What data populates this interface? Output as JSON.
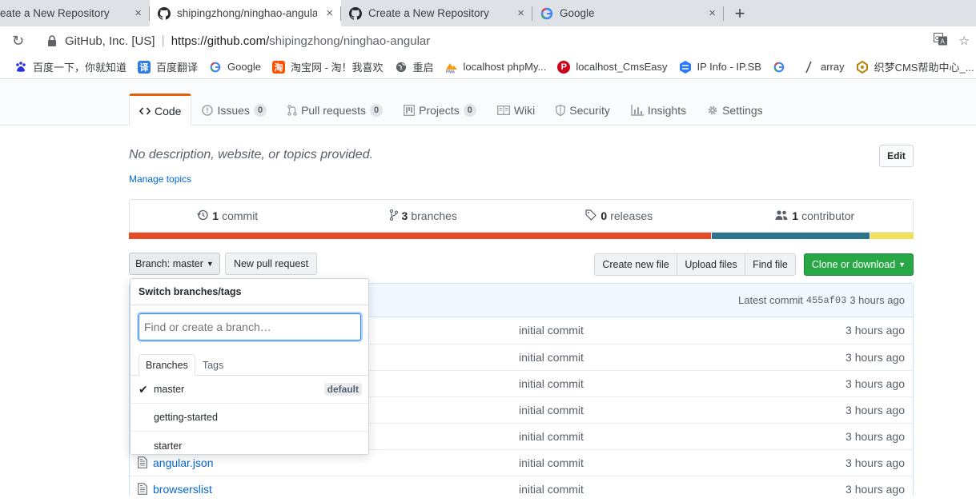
{
  "browser": {
    "tabs": [
      {
        "title": "eate a New Repository",
        "favicon": "none",
        "active": false
      },
      {
        "title": "shipingzhong/ninghao-angula",
        "favicon": "github-icon",
        "active": true
      },
      {
        "title": "Create a New Repository",
        "favicon": "github-icon",
        "active": false
      },
      {
        "title": "Google",
        "favicon": "google-icon",
        "active": false
      }
    ],
    "new_tab_label": "+",
    "close_glyph": "×",
    "site_owner": "GitHub, Inc. [US]",
    "separator": "|",
    "url_host": "https://github.com/",
    "url_path": "shipingzhong/ninghao-angular",
    "bookmarks": [
      {
        "label": "百度一下，你就知道",
        "icon": "baidu-icon",
        "color": "#2932e1"
      },
      {
        "label": "百度翻译",
        "icon": "translate-icon",
        "color": "#2f7de1",
        "glyph": "译"
      },
      {
        "label": "Google",
        "icon": "google-icon",
        "color": "#4285f4"
      },
      {
        "label": "淘宝网 - 淘！我喜欢",
        "icon": "taobao-icon",
        "color": "#ff5000",
        "glyph": "淘"
      },
      {
        "label": "重启",
        "icon": "globe-icon",
        "color": "#5f6368"
      },
      {
        "label": "localhost phpMy...",
        "icon": "pma-icon",
        "color": "#f89c0e"
      },
      {
        "label": "localhost_CmsEasy",
        "icon": "cmseasy-icon",
        "color": "#d0021b",
        "glyph": "P"
      },
      {
        "label": "IP Info - IP.SB",
        "icon": "ipsb-icon",
        "color": "#2979ff"
      },
      {
        "label": "",
        "icon": "google-icon",
        "color": "#4285f4"
      },
      {
        "label": "array",
        "icon": "slash-icon",
        "color": "#5f6368"
      },
      {
        "label": "织梦CMS帮助中心_...",
        "icon": "dedecms-icon",
        "color": "#b8860b"
      }
    ]
  },
  "repo": {
    "nav": [
      {
        "label": "Code",
        "icon": "code-icon",
        "count": null,
        "selected": true
      },
      {
        "label": "Issues",
        "icon": "issue-icon",
        "count": "0",
        "selected": false
      },
      {
        "label": "Pull requests",
        "icon": "pull-request-icon",
        "count": "0",
        "selected": false
      },
      {
        "label": "Projects",
        "icon": "project-icon",
        "count": "0",
        "selected": false
      },
      {
        "label": "Wiki",
        "icon": "book-icon",
        "count": null,
        "selected": false
      },
      {
        "label": "Security",
        "icon": "shield-icon",
        "count": null,
        "selected": false
      },
      {
        "label": "Insights",
        "icon": "graph-icon",
        "count": null,
        "selected": false
      },
      {
        "label": "Settings",
        "icon": "gear-icon",
        "count": null,
        "selected": false
      }
    ],
    "description": "No description, website, or topics provided.",
    "manage_topics": "Manage topics",
    "edit_label": "Edit",
    "summary": {
      "commits": {
        "num": "1",
        "label": "commit"
      },
      "branches": {
        "num": "3",
        "label": "branches"
      },
      "releases": {
        "num": "0",
        "label": "releases"
      },
      "contributors": {
        "num": "1",
        "label": "contributor"
      }
    },
    "language_colors": [
      "#e34c26",
      "#2b7489",
      "#f1e05a"
    ],
    "language_shares": [
      0.743,
      0.202,
      0.055
    ],
    "toolbar": {
      "branch_label": "Branch: master",
      "new_pull_request": "New pull request",
      "create_new_file": "Create new file",
      "upload_files": "Upload files",
      "find_file": "Find file",
      "clone_or_download": "Clone or download"
    },
    "latest_commit": {
      "label": "Latest commit",
      "sha": "455af03",
      "age": "3 hours ago"
    },
    "files": [
      {
        "name": "",
        "message": "initial commit",
        "age": "3 hours ago"
      },
      {
        "name": "",
        "message": "initial commit",
        "age": "3 hours ago"
      },
      {
        "name": "",
        "message": "initial commit",
        "age": "3 hours ago"
      },
      {
        "name": "",
        "message": "initial commit",
        "age": "3 hours ago"
      },
      {
        "name": "",
        "message": "initial commit",
        "age": "3 hours ago"
      },
      {
        "name": "angular.json",
        "message": "initial commit",
        "age": "3 hours ago"
      },
      {
        "name": "browserslist",
        "message": "initial commit",
        "age": "3 hours ago"
      }
    ]
  },
  "branch_dropdown": {
    "header": "Switch branches/tags",
    "filter_placeholder": "Find or create a branch…",
    "tabs": [
      "Branches",
      "Tags"
    ],
    "branches": [
      {
        "name": "master",
        "checked": true,
        "badge": "default"
      },
      {
        "name": "getting-started",
        "checked": false,
        "badge": ""
      },
      {
        "name": "starter",
        "checked": false,
        "badge": ""
      }
    ]
  }
}
